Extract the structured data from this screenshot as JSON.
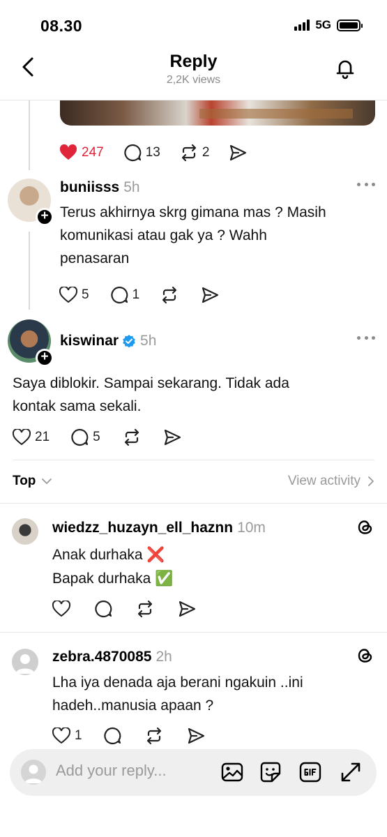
{
  "status": {
    "time": "08.30",
    "network": "5G"
  },
  "nav": {
    "title": "Reply",
    "views": "2,2K views"
  },
  "parent_post": {
    "likes": "247",
    "replies": "13",
    "reposts": "2",
    "like_color": "#e0243a"
  },
  "reply1": {
    "username": "buniisss",
    "time": "5h",
    "text_lines": [
      "Terus akhirnya skrg gimana mas ? Masih",
      "komunikasi atau gak ya ? Wahh",
      "penasaran"
    ],
    "likes": "5",
    "replies": "1"
  },
  "reply2": {
    "username": "kiswinar",
    "time": "5h",
    "verified": true,
    "text_lines": [
      "Saya diblokir. Sampai sekarang. Tidak ada",
      "kontak sama sekali."
    ],
    "likes": "21",
    "replies": "5"
  },
  "sort": {
    "label": "Top",
    "view_activity": "View activity"
  },
  "comments": [
    {
      "username": "wiedzz_huzayn_ell_haznn",
      "time": "10m",
      "lines": [
        "Anak durhaka ❌",
        "Bapak durhaka ✅"
      ]
    },
    {
      "username": "zebra.4870085",
      "time": "2h",
      "lines": [
        "Lha iya denada aja berani ngakuin ..ini",
        "hadeh..manusia apaan ?"
      ],
      "likes": "1"
    }
  ],
  "composer": {
    "placeholder": "Add your reply..."
  },
  "icons": [
    "chevron-left-icon",
    "bell-icon",
    "heart-icon",
    "comment-icon",
    "repost-icon",
    "share-icon",
    "more-icon",
    "verified-icon",
    "threads-icon",
    "image-icon",
    "sticker-icon",
    "gif-icon",
    "expand-icon"
  ]
}
